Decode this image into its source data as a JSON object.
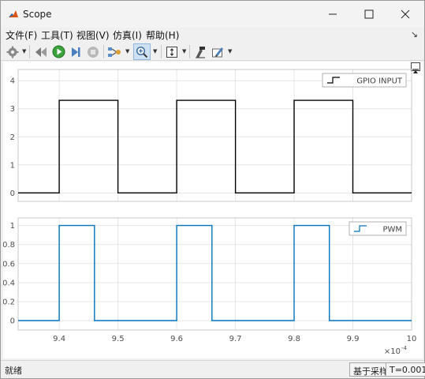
{
  "window": {
    "title": "Scope",
    "minimize_glyph": "—",
    "maximize_glyph": "☐",
    "close_glyph": "✕"
  },
  "menu": {
    "items": [
      "文件(F)",
      "工具(T)",
      "视图(V)",
      "仿真(I)",
      "帮助(H)"
    ],
    "overflow_glyph": "↘"
  },
  "toolbar": {
    "icons": [
      "settings-icon",
      "dropdown",
      "step-back-icon",
      "run-icon",
      "step-forward-icon",
      "stop-icon",
      "signal-select-icon",
      "dropdown",
      "zoom-in-icon",
      "dropdown",
      "autoscale-icon",
      "dropdown",
      "cursor-measure-icon",
      "highlight-icon",
      "dropdown"
    ],
    "accent": "#2a8a2a"
  },
  "status": {
    "left": "就绪",
    "mode": "基于采样",
    "time": "T=0.001"
  },
  "colors": {
    "top_trace": "#000000",
    "bottom_trace": "#0072bd",
    "grid": "#e6e6e6",
    "axis": "#c8c8c8",
    "tick_text": "#4d4d4d"
  },
  "chart_data": [
    {
      "type": "line",
      "step": true,
      "legend": "GPIO INPUT",
      "legend_position": "top-right",
      "xlim": [
        9.33,
        10.0
      ],
      "ylim": [
        -0.3,
        4.4
      ],
      "yticks": [
        "0",
        "1",
        "2",
        "3",
        "4"
      ],
      "ytick_values": [
        0,
        1,
        2,
        3,
        4
      ],
      "grid": true,
      "x": [
        9.33,
        9.4,
        9.4,
        9.5,
        9.5,
        9.6,
        9.6,
        9.7,
        9.7,
        9.8,
        9.8,
        9.9,
        9.9,
        10.0
      ],
      "y": [
        0,
        0,
        3.3,
        3.3,
        0,
        0,
        3.3,
        3.3,
        0,
        0,
        3.3,
        3.3,
        0,
        0
      ],
      "x_scale_note": "×10^-4"
    },
    {
      "type": "line",
      "step": true,
      "legend": "PWM",
      "legend_position": "top-right",
      "xlim": [
        9.33,
        10.0
      ],
      "ylim": [
        -0.1,
        1.08
      ],
      "yticks": [
        "0",
        "0.2",
        "0.4",
        "0.6",
        "0.8",
        "1"
      ],
      "ytick_values": [
        0,
        0.2,
        0.4,
        0.6,
        0.8,
        1
      ],
      "xticks": [
        "9.4",
        "9.5",
        "9.6",
        "9.7",
        "9.8",
        "9.9",
        "10"
      ],
      "xtick_values": [
        9.4,
        9.5,
        9.6,
        9.7,
        9.8,
        9.9,
        10.0
      ],
      "x_exponent_label": "×10",
      "x_exponent_power": "-4",
      "grid": true,
      "x": [
        9.33,
        9.4,
        9.4,
        9.46,
        9.46,
        9.6,
        9.6,
        9.66,
        9.66,
        9.8,
        9.8,
        9.86,
        9.86,
        10.0
      ],
      "y": [
        0,
        0,
        1,
        1,
        0,
        0,
        1,
        1,
        0,
        0,
        1,
        1,
        0,
        0
      ]
    }
  ]
}
